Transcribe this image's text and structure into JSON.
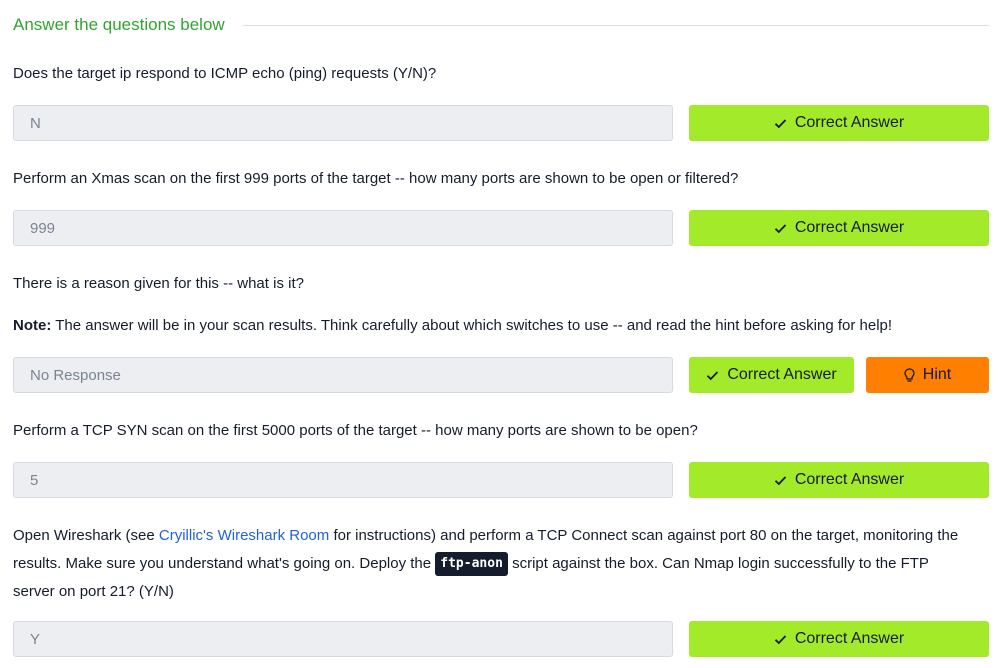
{
  "section": {
    "title": "Answer the questions below"
  },
  "colors": {
    "accent_green": "#a3ea2a",
    "hint_orange": "#ff7f00",
    "title_green": "#2fa52f",
    "link_blue": "#2163d6"
  },
  "questions": [
    {
      "text": "Does the target ip respond to ICMP echo (ping) requests (Y/N)?",
      "answer": "N",
      "button": "Correct Answer",
      "icon": "check-icon"
    },
    {
      "text": "Perform an Xmas scan on the first 999 ports of the target -- how many ports are shown to be open or filtered?",
      "answer": "999",
      "button": "Correct Answer",
      "icon": "check-icon"
    },
    {
      "text": "There is a reason given for this -- what is it?",
      "note_label": "Note:",
      "note_text": " The answer will be in your scan results. Think carefully about which switches to use -- and read the hint before asking for help!",
      "answer": "No Response",
      "button": "Correct Answer",
      "hint": "Hint",
      "icon": "check-icon",
      "hint_icon": "lightbulb-icon"
    },
    {
      "text": "Perform a TCP SYN scan on the first 5000 ports of the target -- how many ports are shown to be open?",
      "answer": "5",
      "button": "Correct Answer",
      "icon": "check-icon"
    },
    {
      "text_1": "Open Wireshark (see ",
      "link": "Cryillic's Wireshark Room",
      "text_2": " for instructions) and perform a TCP Connect scan against port 80 on the target, monitoring the results. Make sure you understand what's going on. Deploy the ",
      "code": "ftp-anon",
      "text_3": " script against the box. Can Nmap login successfully to the FTP server on port 21? (Y/N)",
      "answer": "Y",
      "button": "Correct Answer",
      "icon": "check-icon"
    }
  ]
}
